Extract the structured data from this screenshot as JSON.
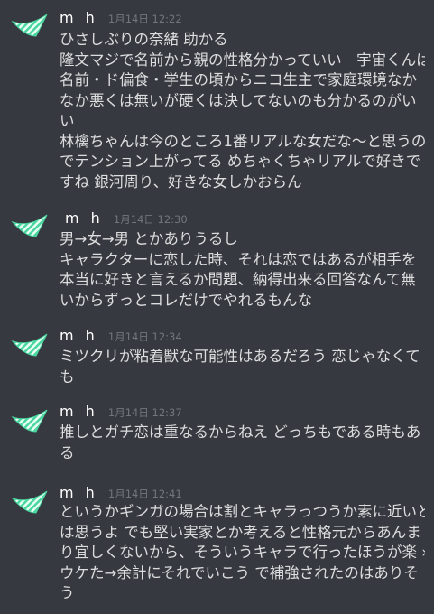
{
  "channel": {
    "background": "#36393f",
    "author_color": "#ffffff",
    "timestamp_color": "#72767d",
    "text_color": "#dcddde",
    "avatar_colors": [
      "#4ad6a0",
      "#e8fff4"
    ]
  },
  "messages": [
    {
      "author": "m h",
      "timestamp": "1月14日 12:22",
      "avatar": "green-striped-pennant-avatar",
      "lines": [
        "ひさしぶりの奈緒 助かる",
        "隆文マジで名前から親の性格分かっていい　宇宙くんは",
        "名前・ド偏食・学生の頃からニコ生主で家庭環境なか",
        "なか悪くは無いが硬くは決してないのも分かるのがい",
        "い",
        "林檎ちゃんは今のところ1番リアルな女だな〜と思うの",
        "でテンション上がってる めちゃくちゃリアルで好きで",
        "すね 銀河周り、好きな女しかおらん"
      ]
    },
    {
      "author": "m h",
      "timestamp": "1月14日 12:30",
      "avatar": "green-striped-pennant-avatar",
      "lines": [
        "男→女→男 とかありうるし",
        "キャラクターに恋した時、それは恋ではあるが相手を",
        "本当に好きと言えるか問題、納得出来る回答なんて無",
        "いからずっとコレだけでやれるもんな"
      ]
    },
    {
      "author": "m h",
      "timestamp": "1月14日 12:34",
      "avatar": "green-striped-pennant-avatar",
      "lines": [
        "ミツクリが粘着獣な可能性はあるだろう 恋じゃなくて",
        "も"
      ]
    },
    {
      "author": "m h",
      "timestamp": "1月14日 12:37",
      "avatar": "green-striped-pennant-avatar",
      "lines": [
        "推しとガチ恋は重なるからねえ どっちもである時もあ",
        "る"
      ]
    },
    {
      "author": "m h",
      "timestamp": "1月14日 12:41",
      "avatar": "green-striped-pennant-avatar",
      "lines": [
        "というかギンガの場合は割とキャラっつうか素に近いと",
        "は思うよ でも堅い実家とか考えると性格元からあんま",
        "り宜しくないから、そういうキャラで行ったほうが楽 ›",
        "ウケた→余計にそれでいこう で補強されたのはありそ",
        "う"
      ]
    }
  ]
}
